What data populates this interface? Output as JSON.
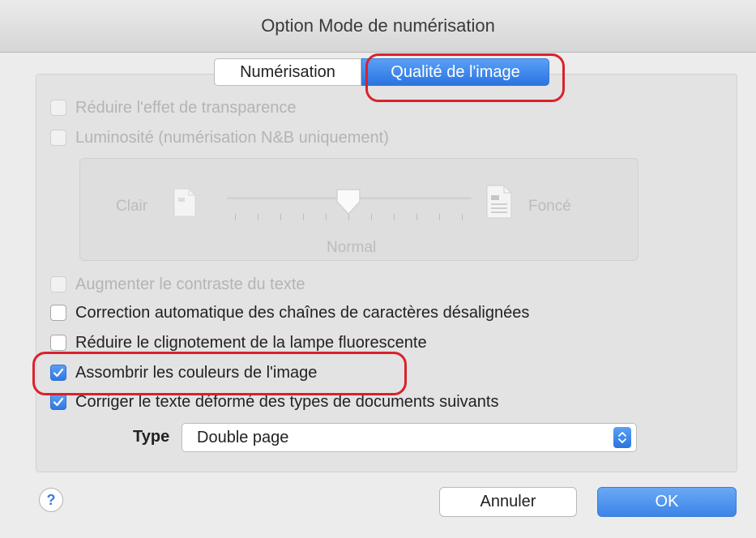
{
  "window": {
    "title": "Option Mode de numérisation"
  },
  "tabs": [
    {
      "label": "Numérisation",
      "active": false
    },
    {
      "label": "Qualité de l'image",
      "active": true
    }
  ],
  "options": [
    {
      "label": "Réduire l'effet de transparence",
      "checked": false,
      "enabled": false
    },
    {
      "label": "Luminosité (numérisation N&B uniquement)",
      "checked": false,
      "enabled": false
    },
    {
      "label": "Augmenter le contraste du texte",
      "checked": false,
      "enabled": false
    },
    {
      "label": "Correction automatique des chaînes de caractères désalignées",
      "checked": false,
      "enabled": true
    },
    {
      "label": "Réduire le clignotement de la lampe fluorescente",
      "checked": false,
      "enabled": true
    },
    {
      "label": "Assombrir les couleurs de l'image",
      "checked": true,
      "enabled": true
    },
    {
      "label": "Corriger le texte déformé des types de documents suivants",
      "checked": true,
      "enabled": true
    }
  ],
  "brightness": {
    "light_label": "Clair",
    "dark_label": "Foncé",
    "value_label": "Normal",
    "level": 0.5,
    "enabled": false
  },
  "type": {
    "label": "Type",
    "selected": "Double page"
  },
  "buttons": {
    "help": "?",
    "cancel": "Annuler",
    "ok": "OK"
  },
  "colors": {
    "accent": "#2f78e2",
    "highlight": "#d9222c"
  }
}
